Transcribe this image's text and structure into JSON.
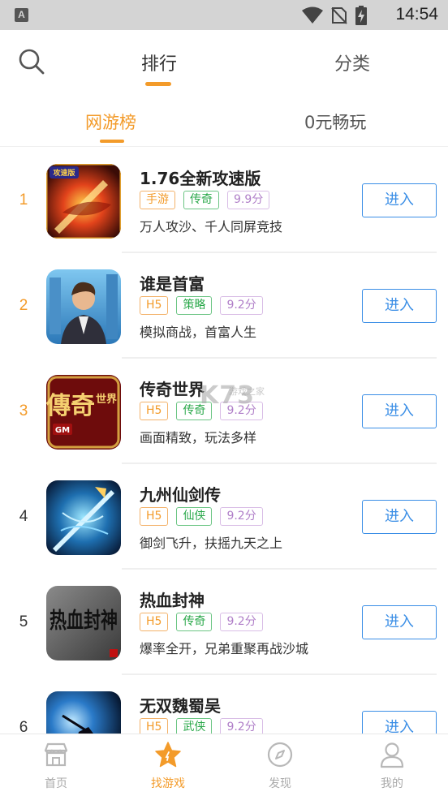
{
  "status_bar": {
    "time": "14:54",
    "app_badge": "A"
  },
  "top_tabs": [
    {
      "label": "排行",
      "active": true
    },
    {
      "label": "分类",
      "active": false
    }
  ],
  "sub_tabs": [
    {
      "label": "网游榜",
      "active": true
    },
    {
      "label": "0元畅玩",
      "active": false
    }
  ],
  "games": [
    {
      "rank": "1",
      "name": "1.76全新攻速版",
      "tags": [
        "手游",
        "传奇",
        "9.9分"
      ],
      "desc": "万人攻沙、千人同屏竞技",
      "button": "进入",
      "icon_text": "攻速版"
    },
    {
      "rank": "2",
      "name": "谁是首富",
      "tags": [
        "H5",
        "策略",
        "9.2分"
      ],
      "desc": "模拟商战，首富人生",
      "button": "进入"
    },
    {
      "rank": "3",
      "name": "传奇世界",
      "tags": [
        "H5",
        "传奇",
        "9.2分"
      ],
      "desc": "画面精致，玩法多样",
      "button": "进入",
      "icon_text_main": "傳奇",
      "icon_text_side": "世界",
      "icon_text_badge": "GM"
    },
    {
      "rank": "4",
      "name": "九州仙剑传",
      "tags": [
        "H5",
        "仙侠",
        "9.2分"
      ],
      "desc": "御剑飞升，扶摇九天之上",
      "button": "进入"
    },
    {
      "rank": "5",
      "name": "热血封神",
      "tags": [
        "H5",
        "传奇",
        "9.2分"
      ],
      "desc": "爆率全开，兄弟重聚再战沙城",
      "button": "进入",
      "icon_text": "热血封神"
    },
    {
      "rank": "6",
      "name": "无双魏蜀吴",
      "tags": [
        "H5",
        "武侠",
        "9.2分"
      ],
      "desc": "",
      "button": "进入"
    }
  ],
  "watermark": {
    "main": "K73",
    "sub": "游戏之家"
  },
  "bottom_nav": [
    {
      "label": "首页",
      "icon": "store-icon",
      "active": false
    },
    {
      "label": "找游戏",
      "icon": "star-icon",
      "active": true
    },
    {
      "label": "发现",
      "icon": "compass-icon",
      "active": false
    },
    {
      "label": "我的",
      "icon": "person-icon",
      "active": false
    }
  ],
  "colors": {
    "accent": "#f39b2a",
    "button_blue": "#3a8ee6",
    "tag_orange": "#f39b2a",
    "tag_green": "#2aa84a",
    "tag_purple": "#b07fc8"
  }
}
